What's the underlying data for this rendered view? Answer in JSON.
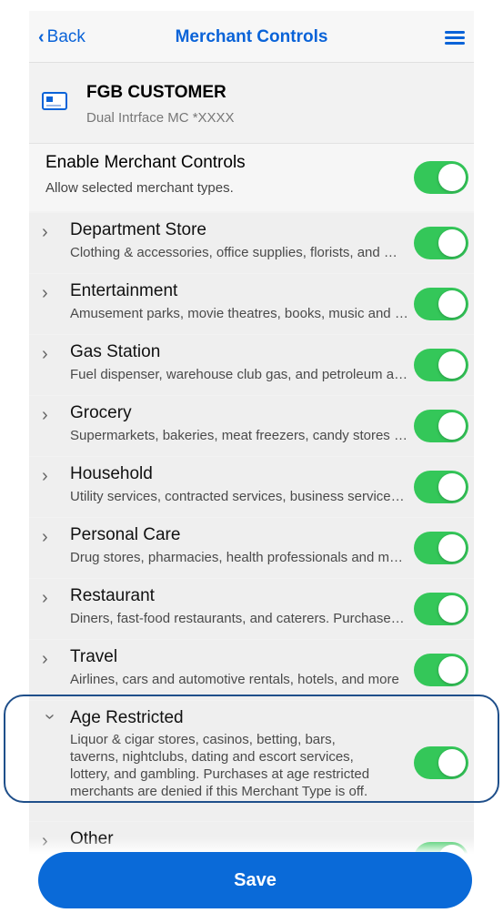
{
  "nav": {
    "back_label": "Back",
    "title": "Merchant Controls",
    "menu_icon": "hamburger-menu-icon"
  },
  "card": {
    "name": "FGB CUSTOMER",
    "subtitle": "Dual Intrface MC *XXXX",
    "icon": "credit-card-icon"
  },
  "enable": {
    "title": "Enable Merchant Controls",
    "subtitle": "Allow selected merchant types.",
    "enabled": true
  },
  "items": [
    {
      "title": "Department Store",
      "desc": "Clothing & accessories, office supplies, florists, and more",
      "enabled": true
    },
    {
      "title": "Entertainment",
      "desc": "Amusement parks, movie theatres, books, music and more",
      "enabled": true
    },
    {
      "title": "Gas Station",
      "desc": "Fuel dispenser, warehouse club gas, and petroleum and more",
      "enabled": true
    },
    {
      "title": "Grocery",
      "desc": "Supermarkets, bakeries, meat freezers, candy stores and more",
      "enabled": true
    },
    {
      "title": "Household",
      "desc": "Utility services, contracted services, business services and more",
      "enabled": true
    },
    {
      "title": "Personal Care",
      "desc": "Drug stores, pharmacies, health professionals and more",
      "enabled": true
    },
    {
      "title": "Restaurant",
      "desc": "Diners, fast-food restaurants, and caterers. Purchases and more",
      "enabled": true
    },
    {
      "title": "Travel",
      "desc": "Airlines, cars and automotive rentals, hotels, and more",
      "enabled": true
    },
    {
      "title": "Age Restricted",
      "desc": "Liquor & cigar stores, casinos, betting, bars, taverns, nightclubs, dating and escort services, lottery, and gambling. Purchases at age restricted merchants are denied if this Merchant Type is off.",
      "enabled": true,
      "expanded": true
    },
    {
      "title": "Other",
      "desc": "",
      "enabled": true
    }
  ],
  "save_label": "Save",
  "colors": {
    "accent": "#0a63d8",
    "toggle_on": "#34c759",
    "highlight_border": "#1f4f8a"
  }
}
